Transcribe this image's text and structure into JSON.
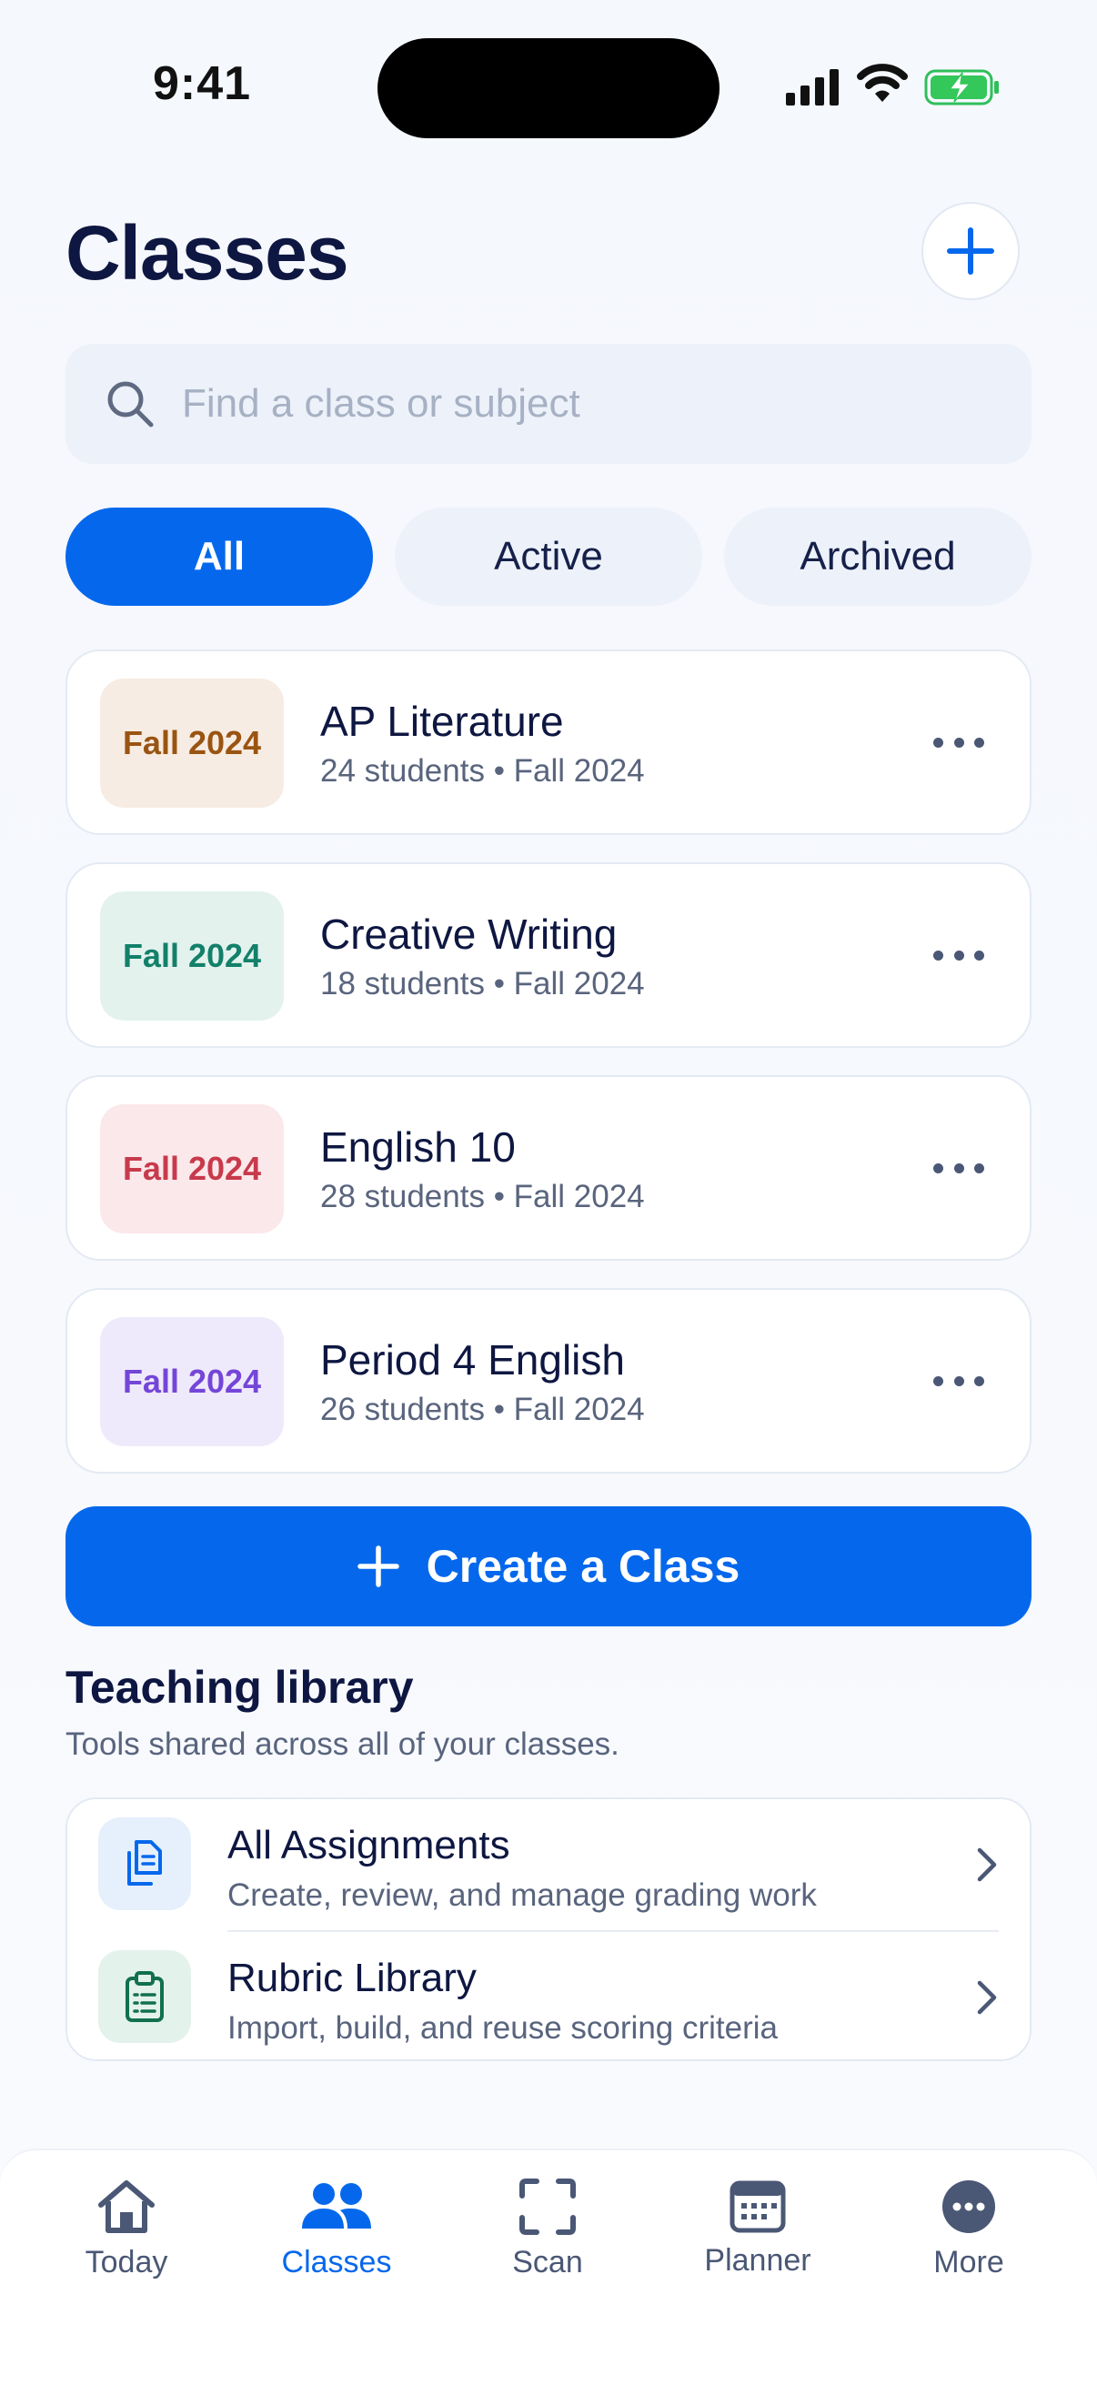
{
  "status_bar": {
    "time": "9:41"
  },
  "header": {
    "title": "Classes"
  },
  "search": {
    "placeholder": "Find a class or subject"
  },
  "filters": [
    {
      "label": "All",
      "active": true
    },
    {
      "label": "Active",
      "active": false
    },
    {
      "label": "Archived",
      "active": false
    }
  ],
  "classes": [
    {
      "badge": "Fall 2024",
      "name": "AP Literature",
      "meta": "24 students • Fall 2024",
      "badge_bg": "#f6ece3",
      "badge_fg": "#9a5411"
    },
    {
      "badge": "Fall 2024",
      "name": "Creative Writing",
      "meta": "18 students • Fall 2024",
      "badge_bg": "#e4f2ee",
      "badge_fg": "#13806a"
    },
    {
      "badge": "Fall 2024",
      "name": "English 10",
      "meta": "28 students • Fall 2024",
      "badge_bg": "#fbe8ea",
      "badge_fg": "#c73a4c"
    },
    {
      "badge": "Fall 2024",
      "name": "Period 4 English",
      "meta": "26 students • Fall 2024",
      "badge_bg": "#efeafb",
      "badge_fg": "#7446d8"
    }
  ],
  "create_button": {
    "label": "Create a Class"
  },
  "library": {
    "title": "Teaching library",
    "subtitle": "Tools shared across all of your classes.",
    "items": [
      {
        "name": "All Assignments",
        "desc": "Create, review, and manage grading work",
        "icon": "documents-icon"
      },
      {
        "name": "Rubric Library",
        "desc": "Import, build, and reuse scoring criteria",
        "icon": "clipboard-icon"
      }
    ]
  },
  "nav": [
    {
      "label": "Today",
      "icon": "home-icon",
      "active": false
    },
    {
      "label": "Classes",
      "icon": "people-icon",
      "active": true
    },
    {
      "label": "Scan",
      "icon": "scan-icon",
      "active": false
    },
    {
      "label": "Planner",
      "icon": "calendar-icon",
      "active": false
    },
    {
      "label": "More",
      "icon": "more-icon",
      "active": false
    }
  ],
  "colors": {
    "accent": "#0568ec",
    "text": "#0e1741",
    "muted": "#59647d"
  }
}
